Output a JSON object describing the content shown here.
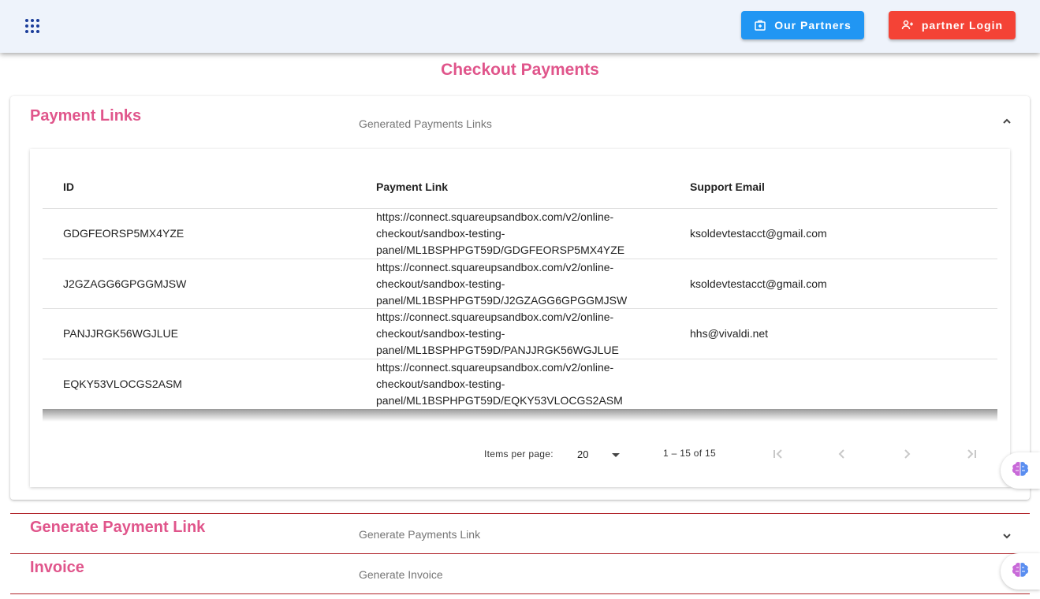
{
  "header": {
    "partners_label": "Our Partners",
    "login_label": "partner Login",
    "partners_color": "#2196f3",
    "login_color": "#f44336"
  },
  "page": {
    "title": "Checkout Payments"
  },
  "payment_links_panel": {
    "title": "Payment Links",
    "description": "Generated Payments Links",
    "table": {
      "columns": [
        "ID",
        "Payment Link",
        "Support Email"
      ],
      "rows": [
        {
          "id": "GDGFEORSP5MX4YZE",
          "link_lines": [
            "https://connect.squareupsandbox.com/v2/online-",
            "checkout/sandbox-testing-",
            "panel/ML1BSPHPGT59D/GDGFEORSP5MX4YZE"
          ],
          "email": "ksoldevtestacct@gmail.com"
        },
        {
          "id": "J2GZAGG6GPGGMJSW",
          "link_lines": [
            "https://connect.squareupsandbox.com/v2/online-",
            "checkout/sandbox-testing-",
            "panel/ML1BSPHPGT59D/J2GZAGG6GPGGMJSW"
          ],
          "email": "ksoldevtestacct@gmail.com"
        },
        {
          "id": "PANJJRGK56WGJLUE",
          "link_lines": [
            "https://connect.squareupsandbox.com/v2/online-",
            "checkout/sandbox-testing-",
            "panel/ML1BSPHPGT59D/PANJJRGK56WGJLUE"
          ],
          "email": "hhs@vivaldi.net"
        },
        {
          "id": "EQKY53VLOCGS2ASM",
          "link_lines": [
            "https://connect.squareupsandbox.com/v2/online-",
            "checkout/sandbox-testing-",
            "panel/ML1BSPHPGT59D/EQKY53VLOCGS2ASM"
          ],
          "email": ""
        }
      ]
    },
    "paginator": {
      "items_per_page_label": "Items per page:",
      "items_per_page_value": "20",
      "range_label": "1 – 15 of 15"
    }
  },
  "generate_link_panel": {
    "title": "Generate Payment Link",
    "description": "Generate Payments Link"
  },
  "invoice_panel": {
    "title": "Invoice",
    "description": "Generate Invoice"
  },
  "icons": [
    "apps-grid-icon",
    "partners-icon",
    "user-login-icon",
    "chevron-up-icon",
    "chevron-down-icon",
    "first-page-icon",
    "prev-page-icon",
    "next-page-icon",
    "last-page-icon",
    "brain-icon"
  ],
  "colors": {
    "accent_pink": "#e0558b",
    "separator_red": "#b0242a"
  }
}
